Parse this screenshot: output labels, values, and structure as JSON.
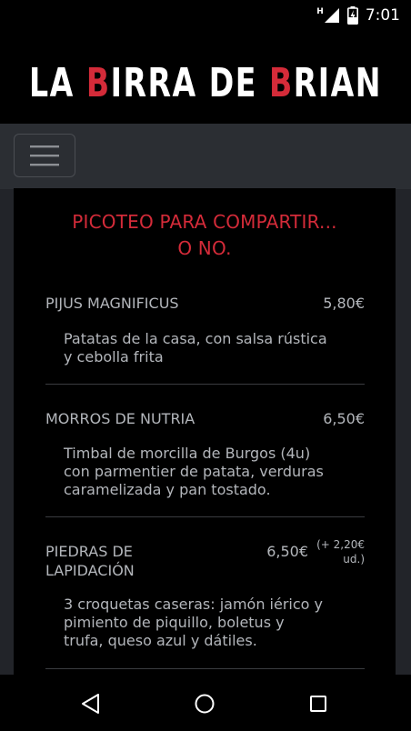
{
  "status_bar": {
    "time": "7:01",
    "network_indicator": "H",
    "icons": [
      "signal-icon",
      "battery-charging-icon"
    ]
  },
  "header": {
    "logo_text": "LA BIRRA DE BRIAN",
    "logo_parts": [
      "LA ",
      "B",
      "IRRA DE ",
      "B",
      "RIAN"
    ],
    "colors": {
      "background": "#000000",
      "text": "#ffffff",
      "accent": "#d42b39"
    }
  },
  "nav": {
    "menu_icon": "hamburger-menu-icon"
  },
  "menu": {
    "section_title_line1": "PICOTEO PARA COMPARTIR...",
    "section_title_line2": "O NO.",
    "items": [
      {
        "name": "PIJUS MAGNIFICUS",
        "price": "5,80€",
        "desc_lines": [
          "Patatas de la casa, con salsa rústica",
          "y cebolla frita"
        ]
      },
      {
        "name": "MORROS DE NUTRIA",
        "price": "6,50€",
        "desc_lines": [
          "Timbal de morcilla de Burgos (4u)",
          "con parmentier de patata, verduras",
          "caramelizada y pan tostado."
        ]
      },
      {
        "name_line1": "PIEDRAS DE",
        "name_line2": "LAPIDACIÓN",
        "price": "6,50€",
        "extra_line1": "(+ 2,20€",
        "extra_line2": "ud.)",
        "desc_lines": [
          "3 croquetas caseras: jamón iérico y",
          "pimiento de piquillo, boletus y",
          "trufa, queso azul y dátiles."
        ]
      }
    ]
  },
  "system_nav": {
    "buttons": [
      "back-icon",
      "home-icon",
      "recents-icon"
    ]
  }
}
